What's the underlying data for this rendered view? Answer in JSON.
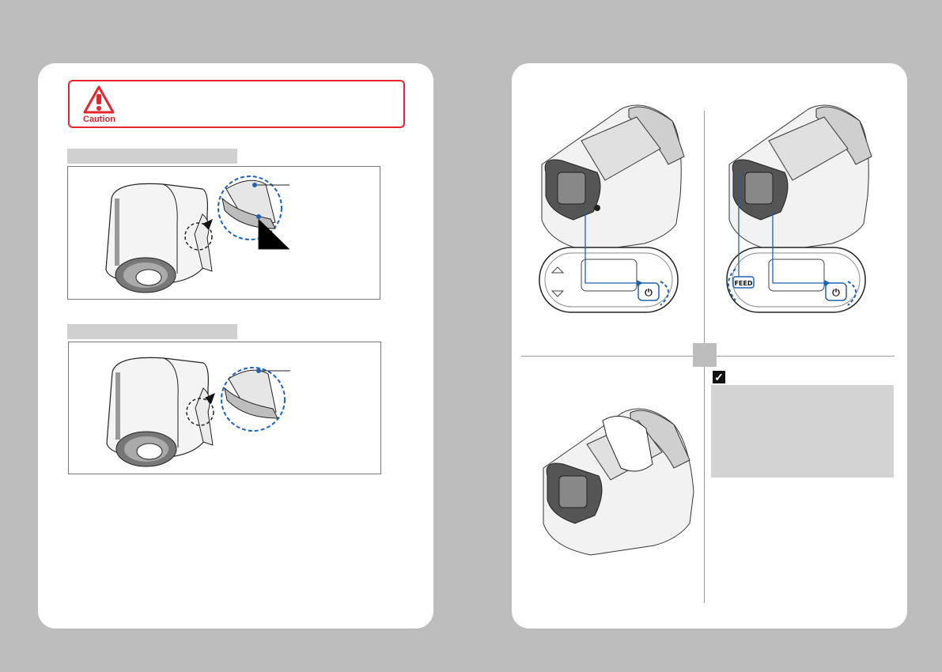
{
  "left_page": {
    "caution": {
      "label": "Caution",
      "icon": "warning-triangle-icon",
      "border_color": "#e8232b"
    },
    "figure1": {
      "description_icon": "paper-roll-illustration",
      "callout_color": "#1f62b4"
    },
    "figure2": {
      "description_icon": "paper-roll-illustration"
    }
  },
  "right_page": {
    "panel_a": {
      "image": "printer-power-button-illustration",
      "button_label": "⏻"
    },
    "panel_b": {
      "image": "printer-feed-power-illustration",
      "feed_label": "FEED",
      "button_label": "⏻"
    },
    "panel_c": {
      "image": "printer-paper-loaded-illustration"
    },
    "note": {
      "icon": "check-icon"
    },
    "accent_color": "#1f62b4"
  }
}
